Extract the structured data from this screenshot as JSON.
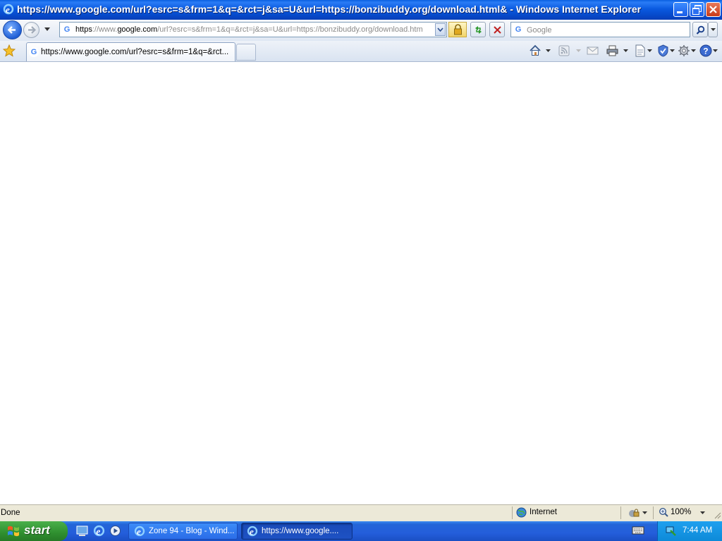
{
  "window": {
    "title": "https://www.google.com/url?esrc=s&frm=1&q=&rct=j&sa=U&url=https://bonzibuddy.org/download.html& - Windows Internet Explorer"
  },
  "address_bar": {
    "url_prefix": "https",
    "url_sep": "://www.",
    "url_domain": "google.com",
    "url_rest": "/url?esrc=s&frm=1&q=&rct=j&sa=U&url=https://bonzibuddy.org/download.htm"
  },
  "search": {
    "placeholder": "Google"
  },
  "tab": {
    "label": "https://www.google.com/url?esrc=s&frm=1&q=&rct..."
  },
  "status": {
    "text": "Done",
    "zone": "Internet",
    "zoom": "100%"
  },
  "taskbar": {
    "start_label": "start",
    "buttons": [
      {
        "label": "Zone 94 - Blog - Wind..."
      },
      {
        "label": "https://www.google...."
      }
    ],
    "clock": "7:44 AM"
  },
  "icons": [
    "ie-icon",
    "back-arrow-icon",
    "forward-arrow-icon",
    "google-icon",
    "lock-icon",
    "refresh-icon",
    "stop-icon",
    "search-icon",
    "favorites-star-icon",
    "home-icon",
    "feeds-icon",
    "mail-icon",
    "print-icon",
    "page-icon",
    "safety-icon",
    "tools-icon",
    "help-icon",
    "globe-icon",
    "keyboard-icon"
  ]
}
